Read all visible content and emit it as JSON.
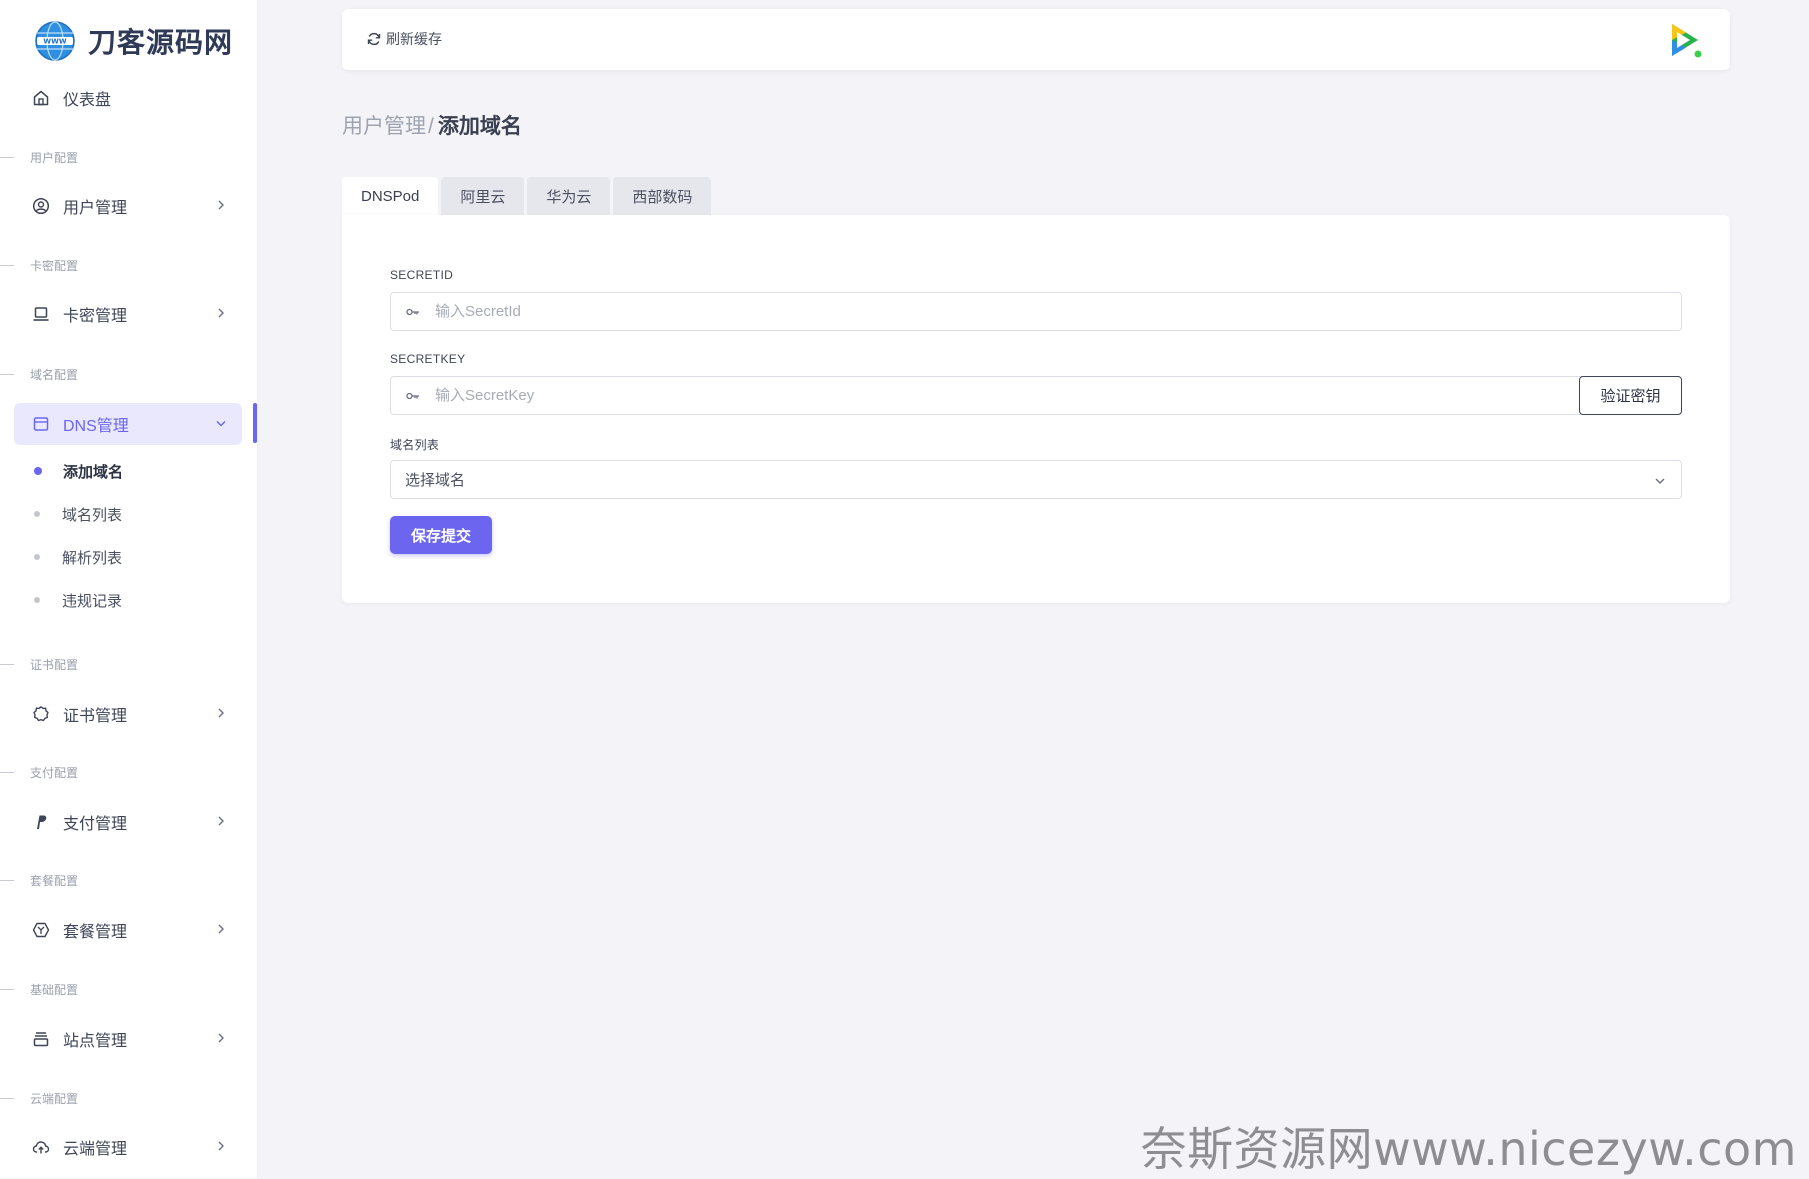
{
  "brand": {
    "name": "刀客源码网"
  },
  "sidebar": {
    "dashboard": "仪表盘",
    "sections": {
      "user": "用户配置",
      "card": "卡密配置",
      "domain": "域名配置",
      "cert": "证书配置",
      "pay": "支付配置",
      "plan": "套餐配置",
      "base": "基础配置",
      "cloud": "云端配置"
    },
    "items": {
      "user": "用户管理",
      "card": "卡密管理",
      "dns": "DNS管理",
      "cert": "证书管理",
      "pay": "支付管理",
      "plan": "套餐管理",
      "site": "站点管理",
      "cloud": "云端管理"
    },
    "dns_sub": [
      "添加域名",
      "域名列表",
      "解析列表",
      "违规记录"
    ],
    "active_sub": "添加域名"
  },
  "topbar": {
    "refresh_label": "刷新缓存"
  },
  "breadcrumb": {
    "parent": "用户管理",
    "separator": "/",
    "current": "添加域名"
  },
  "tabs": [
    "DNSPod",
    "阿里云",
    "华为云",
    "西部数码"
  ],
  "active_tab": "DNSPod",
  "form": {
    "secret_id_label": "SECRETID",
    "secret_id_placeholder": "输入SecretId",
    "secret_id_value": "",
    "secret_key_label": "SECRETKEY",
    "secret_key_placeholder": "输入SecretKey",
    "secret_key_value": "",
    "verify_button": "验证密钥",
    "domain_list_label": "域名列表",
    "domain_select_value": "选择域名",
    "submit_button": "保存提交"
  },
  "watermark": "奈斯资源网www.nicezyw.com",
  "colors": {
    "accent": "#6b65f0",
    "accent_bg": "#e9e8fd",
    "page_bg": "#f4f4f8"
  },
  "icons": {
    "dashboard": "home-icon",
    "user": "user-circle-icon",
    "card": "laptop-icon",
    "dns": "window-icon",
    "cert": "gear-outline-icon",
    "pay": "paypal-icon",
    "plan": "package-icon",
    "site": "stack-icon",
    "cloud": "cloud-upload-icon",
    "refresh": "refresh-icon",
    "key": "key-icon",
    "chevron": "chevron-right-icon"
  }
}
